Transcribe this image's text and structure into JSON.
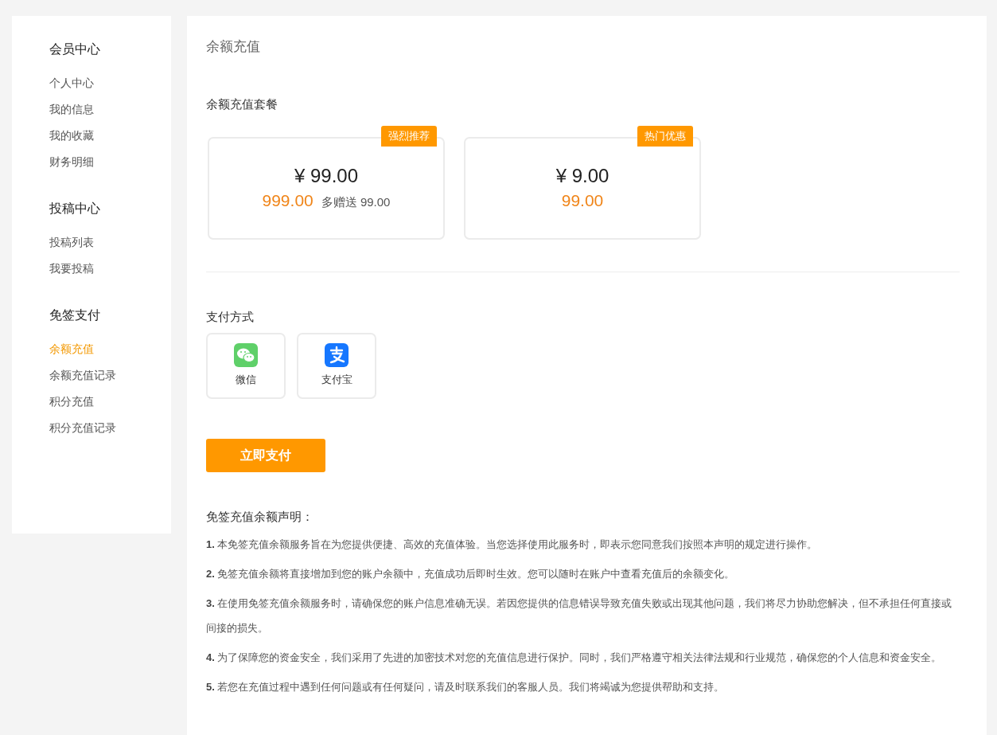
{
  "sidebar": {
    "groups": [
      {
        "title": "会员中心",
        "items": [
          {
            "label": "个人中心",
            "selected": false
          },
          {
            "label": "我的信息",
            "selected": false
          },
          {
            "label": "我的收藏",
            "selected": false
          },
          {
            "label": "财务明细",
            "selected": false
          }
        ]
      },
      {
        "title": "投稿中心",
        "items": [
          {
            "label": "投稿列表",
            "selected": false
          },
          {
            "label": "我要投稿",
            "selected": false
          }
        ]
      },
      {
        "title": "免签支付",
        "items": [
          {
            "label": "余额充值",
            "selected": true
          },
          {
            "label": "余额充值记录",
            "selected": false
          },
          {
            "label": "积分充值",
            "selected": false
          },
          {
            "label": "积分充值记录",
            "selected": false
          }
        ]
      }
    ]
  },
  "page_title": "余额充值",
  "packages_title": "余额充值套餐",
  "packages": [
    {
      "badge": "强烈推荐",
      "price": "¥ 99.00",
      "amount": "999.00",
      "bonus": "多赠送 99.00"
    },
    {
      "badge": "热门优惠",
      "price": "¥ 9.00",
      "amount": "99.00"
    }
  ],
  "payment_title": "支付方式",
  "payment_methods": [
    {
      "kind": "wechat",
      "label": "微信"
    },
    {
      "kind": "alipay",
      "label": "支付宝"
    }
  ],
  "pay_button": "立即支付",
  "notice_title": "免签充值余额声明：",
  "notices": [
    "**1.** 本免签充值余额服务旨在为您提供便捷、高效的充值体验。当您选择使用此服务时，即表示您同意我们按照本声明的规定进行操作。",
    "**2.** 免签充值余额将直接增加到您的账户余额中，充值成功后即时生效。您可以随时在账户中查看充值后的余额变化。",
    "**3.** 在使用免签充值余额服务时，请确保您的账户信息准确无误。若因您提供的信息错误导致充值失败或出现其他问题，我们将尽力协助您解决，但不承担任何直接或间接的损失。",
    "**4.** 为了保障您的资金安全，我们采用了先进的加密技术对您的充值信息进行保护。同时，我们严格遵守相关法律法规和行业规范，确保您的个人信息和资金安全。",
    "**5.** 若您在充值过程中遇到任何问题或有任何疑问，请及时联系我们的客服人员。我们将竭诚为您提供帮助和支持。"
  ]
}
